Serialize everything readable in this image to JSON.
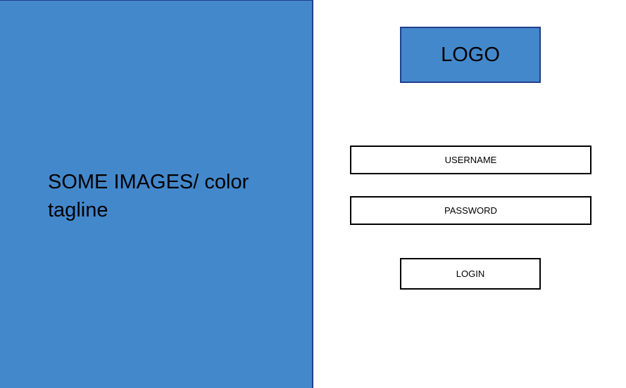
{
  "hero": {
    "tagline": "SOME IMAGES/ color tagline",
    "background_color": "#4488cc"
  },
  "logo": {
    "label": "LOGO"
  },
  "form": {
    "username_label": "USERNAME",
    "password_label": "PASSWORD",
    "login_label": "LOGIN"
  }
}
